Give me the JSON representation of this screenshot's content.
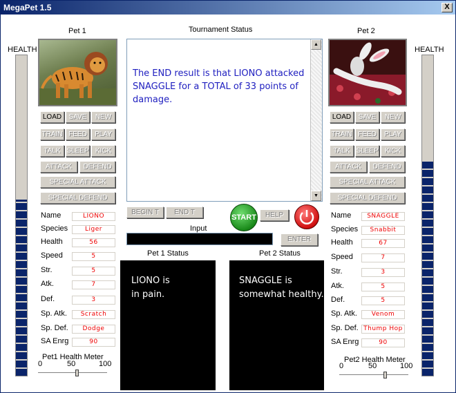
{
  "window": {
    "title": "MegaPet 1.5",
    "close_label": "X"
  },
  "health_label": "HEALTH",
  "pet1": {
    "heading": "Pet 1",
    "health_level": 0.55,
    "buttons": {
      "load": "LOAD",
      "save": "SAVE",
      "new": "NEW",
      "train": "TRAIN",
      "feed": "FEED",
      "play": "PLAY",
      "talk": "TALK",
      "sleep": "SLEEP",
      "kick": "KICK",
      "attack": "ATTACK",
      "defend": "DEFEND",
      "special_attack": "SPECIAL ATTACK",
      "special_defend": "SPECIAL DEFEND"
    },
    "stats": [
      {
        "label": "Name",
        "value": "LIONO"
      },
      {
        "label": "Species",
        "value": "Liger"
      },
      {
        "label": "Health",
        "value": "56"
      },
      {
        "label": "Speed",
        "value": "5"
      },
      {
        "label": "Str.",
        "value": "5"
      },
      {
        "label": "Atk.",
        "value": "7"
      },
      {
        "label": "Def.",
        "value": "3"
      },
      {
        "label": "Sp. Atk.",
        "value": "Scratch"
      },
      {
        "label": "Sp. Def.",
        "value": "Dodge"
      },
      {
        "label": "SA Enrg",
        "value": "90"
      }
    ],
    "meter": {
      "label": "Pet1 Health Meter",
      "min": "0",
      "mid": "50",
      "max": "100",
      "value": 56
    },
    "status_heading": "Pet 1 Status",
    "status_text": [
      "LIONO is",
      "in pain."
    ]
  },
  "pet2": {
    "heading": "Pet 2",
    "health_level": 0.67,
    "buttons": {
      "load": "LOAD",
      "save": "SAVE",
      "new": "NEW",
      "train": "TRAIN",
      "feed": "FEED",
      "play": "PLAY",
      "talk": "TALK",
      "sleep": "SLEEP",
      "kick": "KICK",
      "attack": "ATTACK",
      "defend": "DEFEND",
      "special_attack": "SPECIAL ATTACK",
      "special_defend": "SPECIAL DEFEND"
    },
    "stats": [
      {
        "label": "Name",
        "value": "SNAGGLE"
      },
      {
        "label": "Species",
        "value": "Snabbit"
      },
      {
        "label": "Health",
        "value": "67"
      },
      {
        "label": "Speed",
        "value": "7"
      },
      {
        "label": "Str.",
        "value": "3"
      },
      {
        "label": "Atk.",
        "value": "5"
      },
      {
        "label": "Def.",
        "value": "5"
      },
      {
        "label": "Sp. Atk.",
        "value": "Venom"
      },
      {
        "label": "Sp. Def.",
        "value": "Thump Hop"
      },
      {
        "label": "SA Enrg",
        "value": "90"
      }
    ],
    "meter": {
      "label": "Pet2 Health Meter",
      "min": "0",
      "mid": "50",
      "max": "100",
      "value": 67
    },
    "status_heading": "Pet 2 Status",
    "status_text": [
      "SNAGGLE is",
      "somewhat healthy."
    ]
  },
  "tournament": {
    "heading": "Tournament Status",
    "message": "The END result is that LIONO attacked SNAGGLE for a TOTAL of 33 points of damage.",
    "begin": "BEGIN T",
    "end": "END T",
    "start": "START",
    "help": "HELP",
    "input_label": "Input",
    "enter": "ENTER",
    "input_value": ""
  },
  "colors": {
    "title_bar": "#0a246a",
    "health_fill": "#0a246a",
    "field_text": "#e00000",
    "message": "#2020c0"
  }
}
